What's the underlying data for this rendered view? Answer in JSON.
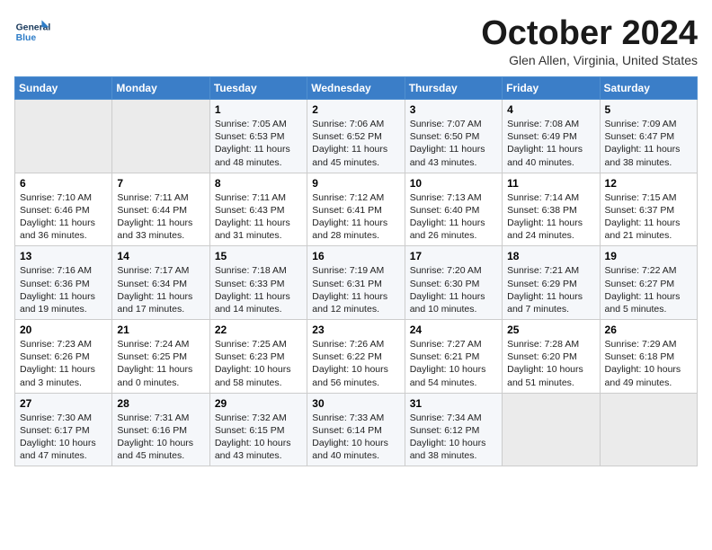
{
  "header": {
    "logo_general": "General",
    "logo_blue": "Blue",
    "title": "October 2024",
    "location": "Glen Allen, Virginia, United States"
  },
  "days_header": [
    "Sunday",
    "Monday",
    "Tuesday",
    "Wednesday",
    "Thursday",
    "Friday",
    "Saturday"
  ],
  "weeks": [
    [
      {
        "day": "",
        "info": ""
      },
      {
        "day": "",
        "info": ""
      },
      {
        "day": "1",
        "info": "Sunrise: 7:05 AM\nSunset: 6:53 PM\nDaylight: 11 hours and 48 minutes."
      },
      {
        "day": "2",
        "info": "Sunrise: 7:06 AM\nSunset: 6:52 PM\nDaylight: 11 hours and 45 minutes."
      },
      {
        "day": "3",
        "info": "Sunrise: 7:07 AM\nSunset: 6:50 PM\nDaylight: 11 hours and 43 minutes."
      },
      {
        "day": "4",
        "info": "Sunrise: 7:08 AM\nSunset: 6:49 PM\nDaylight: 11 hours and 40 minutes."
      },
      {
        "day": "5",
        "info": "Sunrise: 7:09 AM\nSunset: 6:47 PM\nDaylight: 11 hours and 38 minutes."
      }
    ],
    [
      {
        "day": "6",
        "info": "Sunrise: 7:10 AM\nSunset: 6:46 PM\nDaylight: 11 hours and 36 minutes."
      },
      {
        "day": "7",
        "info": "Sunrise: 7:11 AM\nSunset: 6:44 PM\nDaylight: 11 hours and 33 minutes."
      },
      {
        "day": "8",
        "info": "Sunrise: 7:11 AM\nSunset: 6:43 PM\nDaylight: 11 hours and 31 minutes."
      },
      {
        "day": "9",
        "info": "Sunrise: 7:12 AM\nSunset: 6:41 PM\nDaylight: 11 hours and 28 minutes."
      },
      {
        "day": "10",
        "info": "Sunrise: 7:13 AM\nSunset: 6:40 PM\nDaylight: 11 hours and 26 minutes."
      },
      {
        "day": "11",
        "info": "Sunrise: 7:14 AM\nSunset: 6:38 PM\nDaylight: 11 hours and 24 minutes."
      },
      {
        "day": "12",
        "info": "Sunrise: 7:15 AM\nSunset: 6:37 PM\nDaylight: 11 hours and 21 minutes."
      }
    ],
    [
      {
        "day": "13",
        "info": "Sunrise: 7:16 AM\nSunset: 6:36 PM\nDaylight: 11 hours and 19 minutes."
      },
      {
        "day": "14",
        "info": "Sunrise: 7:17 AM\nSunset: 6:34 PM\nDaylight: 11 hours and 17 minutes."
      },
      {
        "day": "15",
        "info": "Sunrise: 7:18 AM\nSunset: 6:33 PM\nDaylight: 11 hours and 14 minutes."
      },
      {
        "day": "16",
        "info": "Sunrise: 7:19 AM\nSunset: 6:31 PM\nDaylight: 11 hours and 12 minutes."
      },
      {
        "day": "17",
        "info": "Sunrise: 7:20 AM\nSunset: 6:30 PM\nDaylight: 11 hours and 10 minutes."
      },
      {
        "day": "18",
        "info": "Sunrise: 7:21 AM\nSunset: 6:29 PM\nDaylight: 11 hours and 7 minutes."
      },
      {
        "day": "19",
        "info": "Sunrise: 7:22 AM\nSunset: 6:27 PM\nDaylight: 11 hours and 5 minutes."
      }
    ],
    [
      {
        "day": "20",
        "info": "Sunrise: 7:23 AM\nSunset: 6:26 PM\nDaylight: 11 hours and 3 minutes."
      },
      {
        "day": "21",
        "info": "Sunrise: 7:24 AM\nSunset: 6:25 PM\nDaylight: 11 hours and 0 minutes."
      },
      {
        "day": "22",
        "info": "Sunrise: 7:25 AM\nSunset: 6:23 PM\nDaylight: 10 hours and 58 minutes."
      },
      {
        "day": "23",
        "info": "Sunrise: 7:26 AM\nSunset: 6:22 PM\nDaylight: 10 hours and 56 minutes."
      },
      {
        "day": "24",
        "info": "Sunrise: 7:27 AM\nSunset: 6:21 PM\nDaylight: 10 hours and 54 minutes."
      },
      {
        "day": "25",
        "info": "Sunrise: 7:28 AM\nSunset: 6:20 PM\nDaylight: 10 hours and 51 minutes."
      },
      {
        "day": "26",
        "info": "Sunrise: 7:29 AM\nSunset: 6:18 PM\nDaylight: 10 hours and 49 minutes."
      }
    ],
    [
      {
        "day": "27",
        "info": "Sunrise: 7:30 AM\nSunset: 6:17 PM\nDaylight: 10 hours and 47 minutes."
      },
      {
        "day": "28",
        "info": "Sunrise: 7:31 AM\nSunset: 6:16 PM\nDaylight: 10 hours and 45 minutes."
      },
      {
        "day": "29",
        "info": "Sunrise: 7:32 AM\nSunset: 6:15 PM\nDaylight: 10 hours and 43 minutes."
      },
      {
        "day": "30",
        "info": "Sunrise: 7:33 AM\nSunset: 6:14 PM\nDaylight: 10 hours and 40 minutes."
      },
      {
        "day": "31",
        "info": "Sunrise: 7:34 AM\nSunset: 6:12 PM\nDaylight: 10 hours and 38 minutes."
      },
      {
        "day": "",
        "info": ""
      },
      {
        "day": "",
        "info": ""
      }
    ]
  ]
}
